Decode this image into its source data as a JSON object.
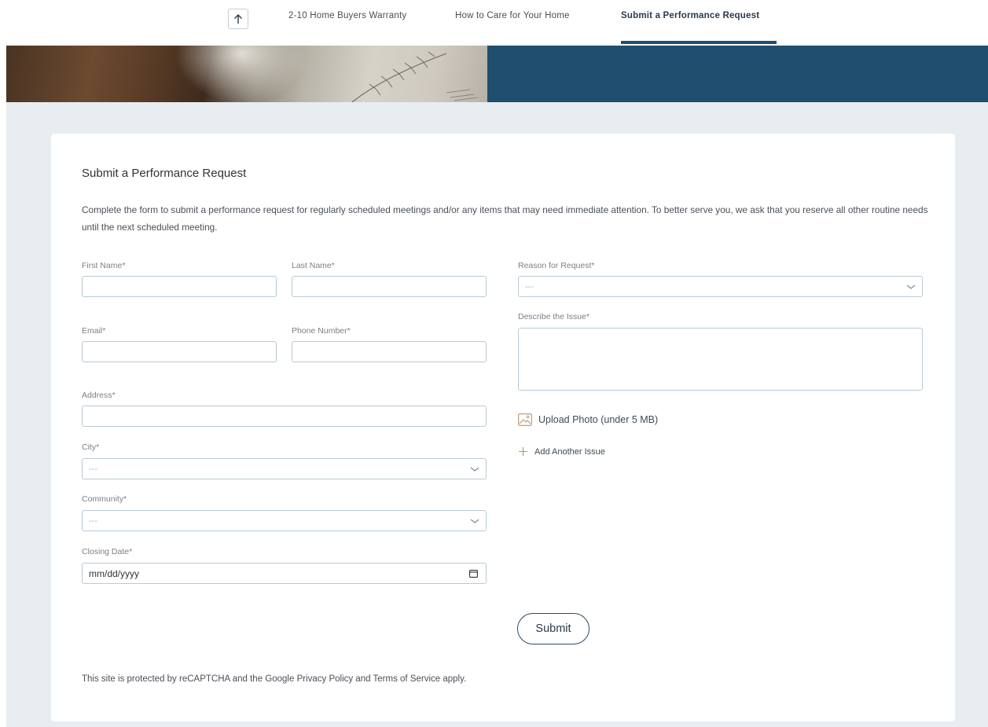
{
  "nav": {
    "up_icon": "arrow-up-icon",
    "links": [
      {
        "label": "2-10 Home Buyers Warranty",
        "active": false
      },
      {
        "label": "How to Care for Your Home",
        "active": false
      },
      {
        "label": "Submit a Performance Request",
        "active": true
      }
    ]
  },
  "colors": {
    "accent": "#1f4e6e",
    "page_bg": "#e8edf2",
    "card_bg": "#ffffff",
    "input_border": "#b9cad6"
  },
  "form": {
    "title": "Submit a Performance Request",
    "intro": "Complete the form to submit a performance request for regularly scheduled meetings and/or any items that may need immediate attention. To better serve you, we ask that you reserve all other routine needs until the next scheduled meeting.",
    "first_name": {
      "label": "First Name*",
      "value": ""
    },
    "last_name": {
      "label": "Last Name*",
      "value": ""
    },
    "email": {
      "label": "Email*",
      "value": ""
    },
    "phone": {
      "label": "Phone Number*",
      "value": ""
    },
    "address": {
      "label": "Address*",
      "value": ""
    },
    "city": {
      "label": "City*",
      "selected": "---"
    },
    "community": {
      "label": "Community*",
      "selected": "---"
    },
    "closing_date": {
      "label": "Closing Date*",
      "placeholder": "mm/dd/yyyy"
    },
    "reason": {
      "label": "Reason for Request*",
      "selected": "---"
    },
    "describe": {
      "label": "Describe the Issue*",
      "value": ""
    },
    "upload_label": "Upload Photo (under 5 MB)",
    "add_issue_label": "Add Another Issue",
    "submit_label": "Submit"
  },
  "footer": {
    "recaptcha_prefix": "This site is protected by reCAPTCHA and the Google ",
    "privacy_link": "Privacy Policy",
    "and_text": " and ",
    "terms_link": "Terms of Service",
    "suffix": " apply."
  }
}
